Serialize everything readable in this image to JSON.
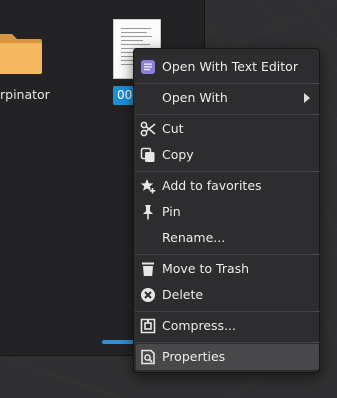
{
  "file_manager": {
    "folder_label": "rpinator",
    "file_label": "00"
  },
  "context_menu": {
    "items": [
      {
        "label": "Open With Text Editor",
        "icon": "text-editor-icon"
      },
      {
        "label": "Open With",
        "icon": "none",
        "submenu": true
      },
      {
        "label": "Cut",
        "icon": "scissors-icon"
      },
      {
        "label": "Copy",
        "icon": "copy-icon"
      },
      {
        "label": "Add to favorites",
        "icon": "star-plus-icon"
      },
      {
        "label": "Pin",
        "icon": "pin-icon"
      },
      {
        "label": "Rename...",
        "icon": "none"
      },
      {
        "label": "Move to Trash",
        "icon": "trash-icon"
      },
      {
        "label": "Delete",
        "icon": "delete-icon"
      },
      {
        "label": "Compress...",
        "icon": "archive-icon"
      },
      {
        "label": "Properties",
        "icon": "properties-icon",
        "highlighted": true
      }
    ]
  },
  "colors": {
    "menu_background": "#2d2d2f",
    "highlight": "#48484b",
    "selection_blue": "#1d8fd6",
    "folder_yellow": "#f2b35b"
  }
}
